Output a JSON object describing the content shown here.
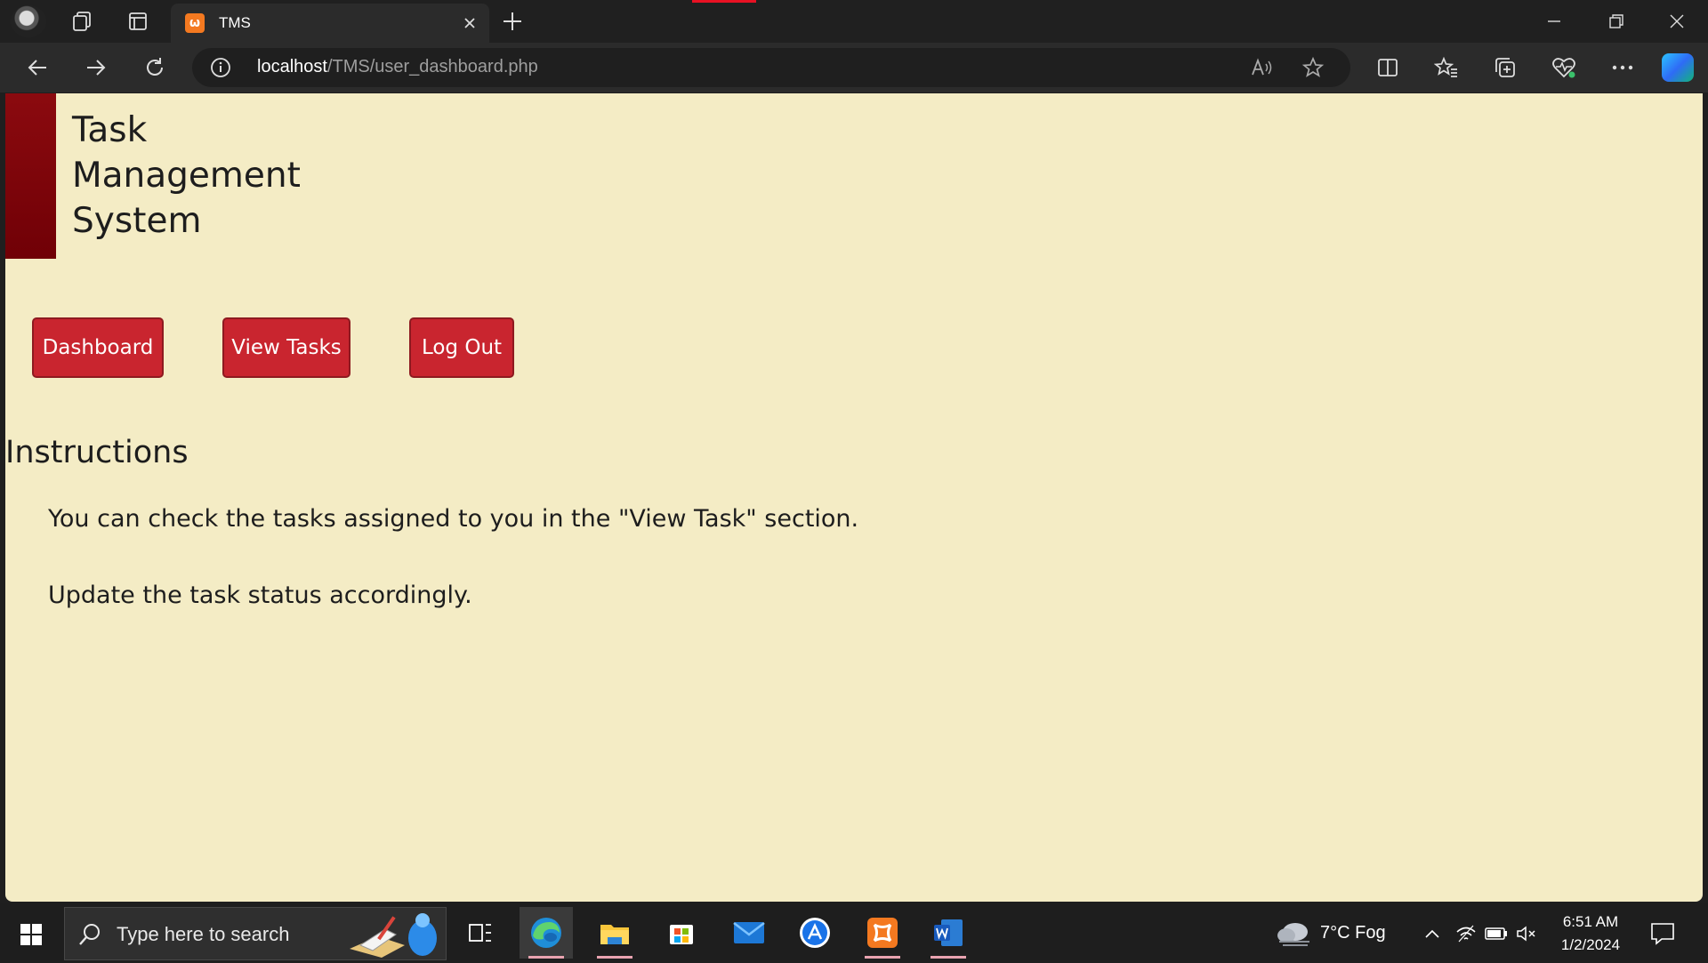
{
  "browser": {
    "tab_title": "TMS",
    "tab_favicon": "xampp-icon",
    "url_host": "localhost",
    "url_path": "/TMS/user_dashboard.php"
  },
  "page": {
    "site_title_lines": [
      "Task",
      "Management",
      "System"
    ],
    "nav": {
      "dashboard": "Dashboard",
      "view_tasks": "View Tasks",
      "log_out": "Log Out"
    },
    "section_heading": "Instructions",
    "instructions": [
      "You can check the tasks assigned to you in the \"View Task\" section.",
      "Update the task status accordingly."
    ]
  },
  "taskbar": {
    "search_placeholder": "Type here to search",
    "weather": "7°C  Fog",
    "time": "6:51 AM",
    "date": "1/2/2024"
  },
  "colors": {
    "page_background": "#f4ecc5",
    "header_accent": "#8b0a0f",
    "button": "#c9252f",
    "text": "#1d1d1d"
  }
}
